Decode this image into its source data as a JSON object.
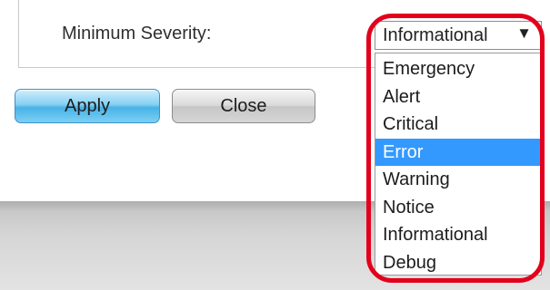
{
  "form": {
    "severity_label": "Minimum Severity:",
    "severity_value": "Informational"
  },
  "dropdown": {
    "options": [
      {
        "label": "Emergency"
      },
      {
        "label": "Alert"
      },
      {
        "label": "Critical"
      },
      {
        "label": "Error"
      },
      {
        "label": "Warning"
      },
      {
        "label": "Notice"
      },
      {
        "label": "Informational"
      },
      {
        "label": "Debug"
      }
    ],
    "highlighted_option": "Error"
  },
  "buttons": {
    "apply_label": "Apply",
    "close_label": "Close"
  },
  "icons": {
    "dropdown_arrow": "caret-down-icon"
  },
  "colors": {
    "highlight_outline": "#e3001b",
    "selected_option_bg": "#3399ff",
    "apply_button": "#48b2e6"
  }
}
